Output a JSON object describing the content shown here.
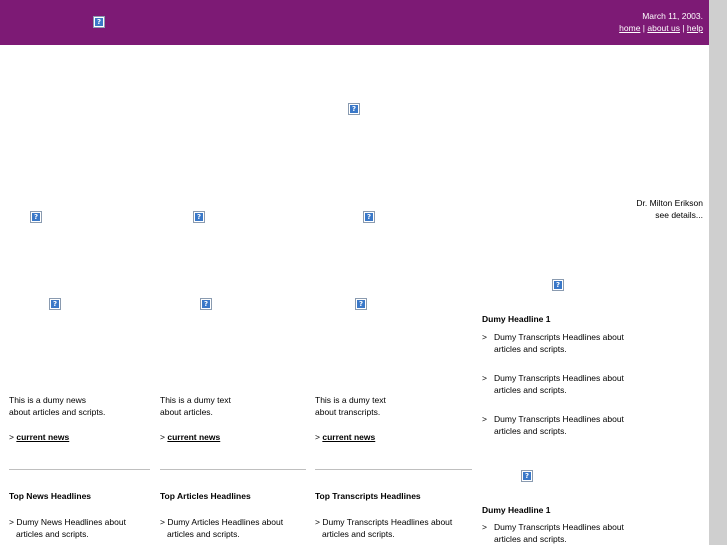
{
  "header": {
    "date": "March 11, 2003.",
    "links": [
      "home",
      "about us",
      "help"
    ],
    "separator": " | "
  },
  "featured": {
    "caption_line1": "Dr. Milton Erikson",
    "caption_line2": "see details..."
  },
  "columns": [
    {
      "intro_line1": "This is a dumy news",
      "intro_line2": "about articles and scripts.",
      "link_prefix": ">",
      "link": "current news",
      "heading": "Top News Headlines",
      "item_prefix": ">",
      "item_line1": "Dumy News Headlines about",
      "item_line2": "articles and scripts."
    },
    {
      "intro_line1": "This is a dumy text",
      "intro_line2": "about articles.",
      "link_prefix": ">",
      "link": "current news",
      "heading": "Top Articles Headlines",
      "item_prefix": ">",
      "item_line1": "Dumy Articles Headlines about",
      "item_line2": "articles and scripts."
    },
    {
      "intro_line1": "This is a dumy text",
      "intro_line2": "about transcripts.",
      "link_prefix": ">",
      "link": "current news",
      "heading": "Top Transcripts Headlines",
      "item_prefix": ">",
      "item_line1": "Dumy Transcripts Headlines about",
      "item_line2": "articles and scripts."
    }
  ],
  "right_panel": {
    "block1": {
      "headline": "Dumy Headline 1",
      "items": [
        {
          "prefix": ">",
          "line1": "Dumy Transcripts Headlines about",
          "line2": "articles and scripts."
        },
        {
          "prefix": ">",
          "line1": "Dumy Transcripts Headlines about",
          "line2": "articles and scripts."
        },
        {
          "prefix": ">",
          "line1": "Dumy Transcripts Headlines about",
          "line2": "articles and scripts."
        }
      ]
    },
    "block2": {
      "headline": "Dumy Headline 1",
      "items": [
        {
          "prefix": ">",
          "line1": "Dumy Transcripts Headlines about",
          "line2": "articles and scripts."
        }
      ]
    }
  }
}
